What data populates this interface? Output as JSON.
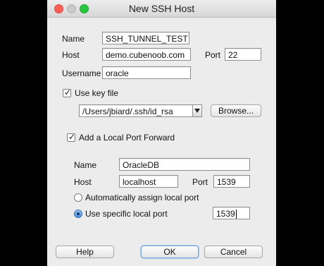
{
  "window": {
    "title": "New SSH Host"
  },
  "connection": {
    "name_label": "Name",
    "name_value": "SSH_TUNNEL_TEST",
    "host_label": "Host",
    "host_value": "demo.cubenoob.com",
    "port_label": "Port",
    "port_value": "22",
    "username_label": "Username",
    "username_value": "oracle"
  },
  "key_file": {
    "checkbox_label": "Use key file",
    "checked": true,
    "path_value": "/Users/jbiard/.ssh/id_rsa",
    "browse_label": "Browse..."
  },
  "port_forward": {
    "checkbox_label": "Add a Local Port Forward",
    "checked": true,
    "name_label": "Name",
    "name_value": "OracleDB",
    "host_label": "Host",
    "host_value": "localhost",
    "port_label": "Port",
    "port_value": "1539",
    "auto_assign_label": "Automatically assign local port",
    "specific_port_label": "Use specific local port",
    "specific_port_value": "1539",
    "selected_option": "specific"
  },
  "buttons": {
    "help": "Help",
    "ok": "OK",
    "cancel": "Cancel"
  },
  "colors": {
    "close": "#fd5f57",
    "minimize": "#c9c9c9",
    "maximize": "#2ac73e",
    "radio_selected": "#4f8ed9"
  }
}
